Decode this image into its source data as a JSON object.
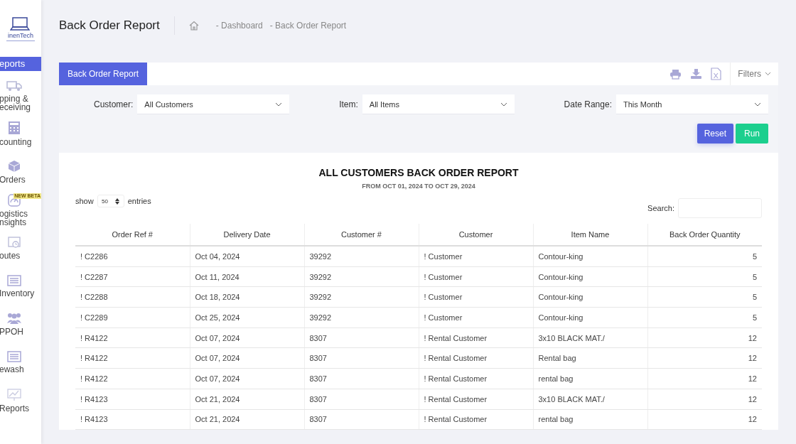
{
  "logo": {
    "name": "inenTech"
  },
  "sidebar": {
    "items": [
      {
        "label": "eports",
        "kind": "plain",
        "selected": true
      },
      {
        "label": "pping &\neceiving",
        "kind": "truck",
        "selected": false
      },
      {
        "label": "counting",
        "kind": "calculator",
        "selected": false
      },
      {
        "label": "Orders",
        "kind": "box",
        "selected": false
      },
      {
        "label": "ogistics\nnsights",
        "kind": "gauge",
        "selected": false,
        "badge": "NEW BETA"
      },
      {
        "label": "outes",
        "kind": "calendar",
        "selected": false
      },
      {
        "label": "Inventory",
        "kind": "list",
        "selected": false
      },
      {
        "label": "PPOH",
        "kind": "people",
        "selected": false
      },
      {
        "label": "ewash",
        "kind": "list",
        "selected": false
      },
      {
        "label": "Reports",
        "kind": "chart",
        "selected": false
      }
    ]
  },
  "header": {
    "title": "Back Order Report",
    "breadcrumb": [
      "- Dashboard",
      "- Back Order Report"
    ]
  },
  "tabs": [
    {
      "label": "Back Order Report",
      "selected": true
    }
  ],
  "filters_button": "Filters",
  "filters": [
    {
      "label": "Customer:",
      "value": "All Customers"
    },
    {
      "label": "Item:",
      "value": "All Items"
    },
    {
      "label": "Date Range:",
      "value": "This Month"
    }
  ],
  "buttons": {
    "reset": "Reset",
    "run": "Run"
  },
  "report": {
    "title": "ALL CUSTOMERS BACK ORDER REPORT",
    "subtitle": "FROM OCT 01, 2024 TO OCT 29, 2024"
  },
  "length": {
    "before": "show",
    "value": "50",
    "after": "entries"
  },
  "search": {
    "label": "Search:"
  },
  "table": {
    "columns": [
      "Order Ref #",
      "Delivery Date",
      "Customer #",
      "Customer",
      "Item Name",
      "Back Order Quantity"
    ],
    "rows": [
      [
        "! C2286",
        "Oct 04, 2024",
        "39292",
        "! Customer",
        "Contour-king",
        "5"
      ],
      [
        "! C2287",
        "Oct 11, 2024",
        "39292",
        "! Customer",
        "Contour-king",
        "5"
      ],
      [
        "! C2288",
        "Oct 18, 2024",
        "39292",
        "! Customer",
        "Contour-king",
        "5"
      ],
      [
        "! C2289",
        "Oct 25, 2024",
        "39292",
        "! Customer",
        "Contour-king",
        "5"
      ],
      [
        "! R4122",
        "Oct 07, 2024",
        "8307",
        "! Rental Customer",
        "3x10 BLACK MAT./",
        "12"
      ],
      [
        "! R4122",
        "Oct 07, 2024",
        "8307",
        "! Rental Customer",
        "Rental bag",
        "12"
      ],
      [
        "! R4122",
        "Oct 07, 2024",
        "8307",
        "! Rental Customer",
        "rental bag",
        "12"
      ],
      [
        "! R4123",
        "Oct 21, 2024",
        "8307",
        "! Rental Customer",
        "3x10 BLACK MAT./",
        "12"
      ],
      [
        "! R4123",
        "Oct 21, 2024",
        "8307",
        "! Rental Customer",
        "rental bag",
        "12"
      ]
    ]
  }
}
